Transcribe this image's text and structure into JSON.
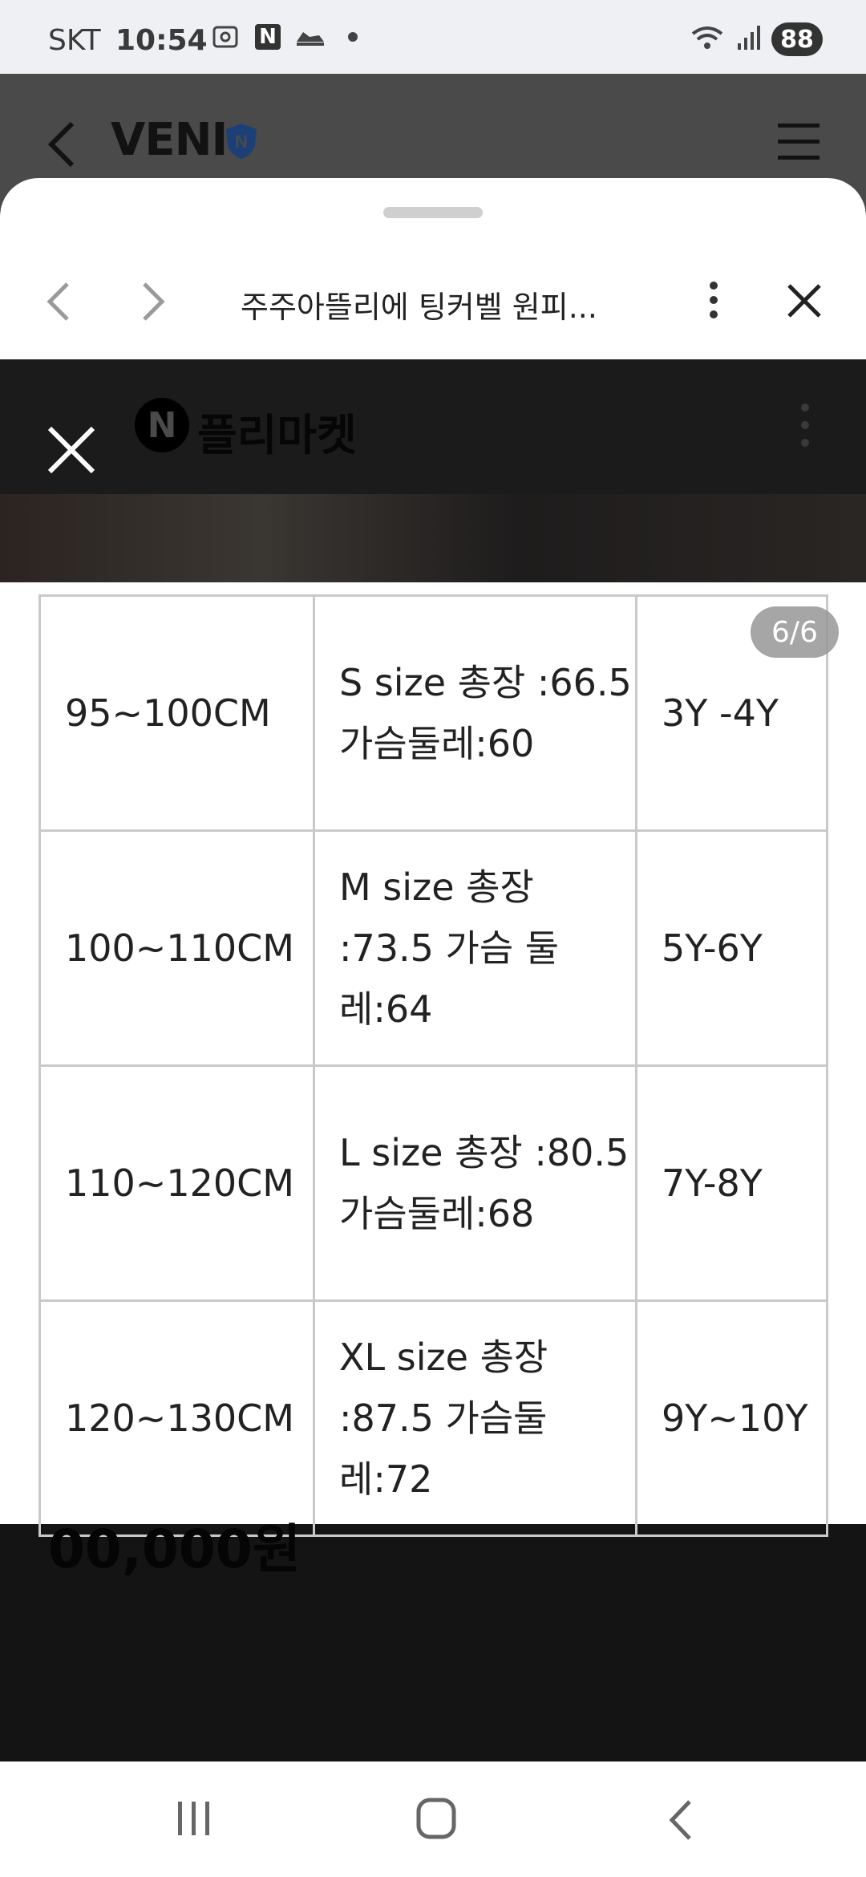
{
  "status_bar": {
    "carrier": "SKT",
    "time": "10:54",
    "notification_icons": [
      "screenshot-icon",
      "naver-n-icon",
      "shoe-icon"
    ],
    "battery": "88"
  },
  "app_header": {
    "brand": "VENI",
    "shield_letter": "N"
  },
  "sheet": {
    "page_title": "주주아뜰리에 팅커벨 원피..."
  },
  "webpage": {
    "logo_letter": "N",
    "logo_text": "플리마켓"
  },
  "image_viewer": {
    "page_indicator": "6/6",
    "table": {
      "rows": [
        {
          "height": "95~100CM",
          "size": "S size 총장 :66.5  가슴둘레:60",
          "age": "3Y -4Y"
        },
        {
          "height": "100~110CM",
          "size": "M size 총장 :73.5 가슴 둘레:64",
          "age": "5Y-6Y"
        },
        {
          "height": "110~120CM",
          "size": "L  size 총장 :80.5 가슴둘레:68",
          "age": "7Y-8Y"
        },
        {
          "height": "120~130CM",
          "size": "XL  size 총장 :87.5 가슴둘레:72",
          "age": "9Y~10Y"
        }
      ]
    },
    "price_peek": "00,000원"
  },
  "thumbnails": {
    "count": 6,
    "active_index": 6
  },
  "colors": {
    "sheet_bg": "#ffffff",
    "dim_bg": "#141414",
    "border": "#c9c9c9",
    "badge_bg": "#969696"
  }
}
